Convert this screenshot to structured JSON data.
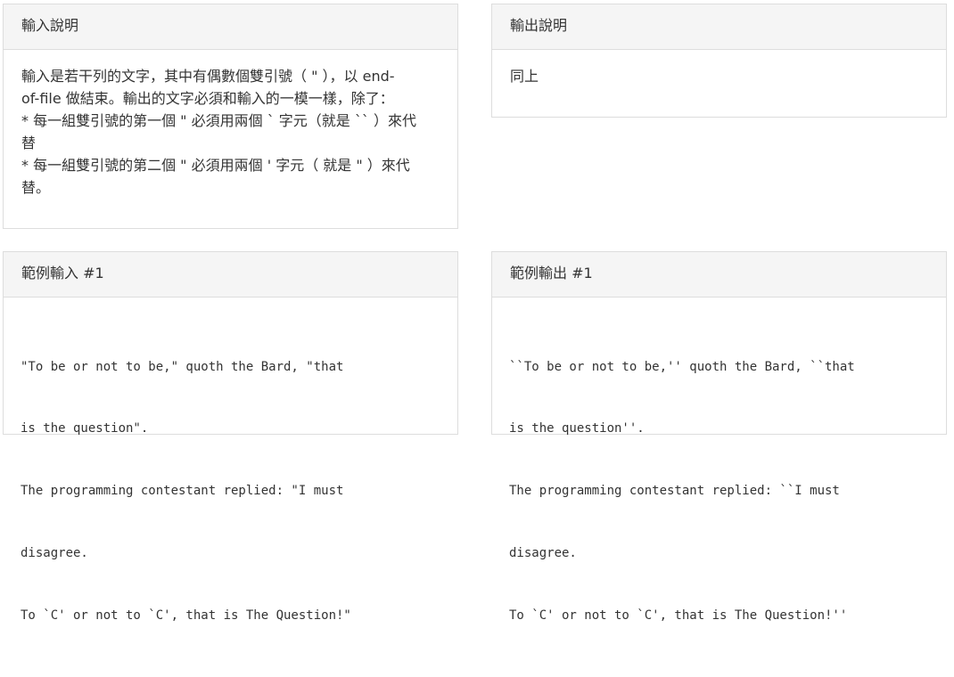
{
  "input_panel": {
    "heading": "輸入說明",
    "lines": [
      "輸入是若干列的文字，其中有偶數個雙引號（ \" ），以 end-",
      "of-file 做結束。輸出的文字必須和輸入的一模一樣，除了：",
      "* 每一組雙引號的第一個 \" 必須用兩個 ` 字元（就是 `` ）來代",
      "替",
      "* 每一組雙引號的第二個 \" 必須用兩個 ' 字元（ 就是 \" ）來代",
      "替。"
    ]
  },
  "output_panel": {
    "heading": "輸出說明",
    "body": "同上"
  },
  "sample_input_panel": {
    "heading": "範例輸入 #1",
    "lines": [
      "\"To be or not to be,\" quoth the Bard, \"that",
      "is the question\".",
      "The programming contestant replied: \"I must",
      "disagree.",
      "To `C' or not to `C', that is The Question!\""
    ]
  },
  "sample_output_panel": {
    "heading": "範例輸出 #1",
    "lines": [
      "``To be or not to be,'' quoth the Bard, ``that",
      "is the question''.",
      "The programming contestant replied: ``I must",
      "disagree.",
      "To `C' or not to `C', that is The Question!''"
    ]
  }
}
